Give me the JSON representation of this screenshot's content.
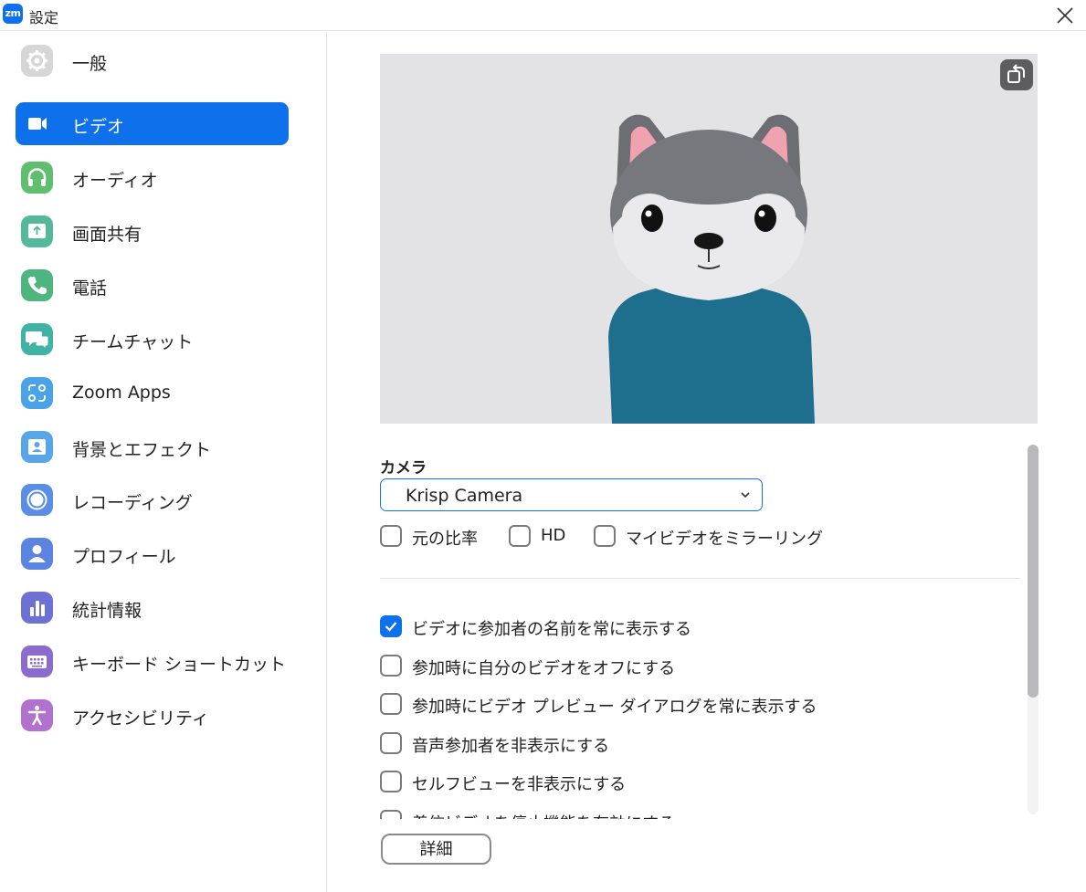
{
  "window": {
    "logo": "zm",
    "title": "設定"
  },
  "sidebar": {
    "items": [
      {
        "label": "一般",
        "icon": "gear-icon",
        "color": "#d6d6d6"
      },
      {
        "label": "ビデオ",
        "icon": "video-camera-icon",
        "color": "#0e71eb",
        "active": true
      },
      {
        "label": "オーディオ",
        "icon": "headphones-icon",
        "color": "#5fbf6e"
      },
      {
        "label": "画面共有",
        "icon": "share-screen-icon",
        "color": "#55b89a"
      },
      {
        "label": "電話",
        "icon": "phone-icon",
        "color": "#4fb57e"
      },
      {
        "label": "チームチャット",
        "icon": "chat-icon",
        "color": "#3fb4a6"
      },
      {
        "label": "Zoom Apps",
        "icon": "apps-icon",
        "color": "#4aa3e6"
      },
      {
        "label": "背景とエフェクト",
        "icon": "background-icon",
        "color": "#58a6e8"
      },
      {
        "label": "レコーディング",
        "icon": "record-icon",
        "color": "#5a8ee6"
      },
      {
        "label": "プロフィール",
        "icon": "profile-icon",
        "color": "#5b84e0"
      },
      {
        "label": "統計情報",
        "icon": "statistics-icon",
        "color": "#6c72d4"
      },
      {
        "label": "キーボード ショートカット",
        "icon": "keyboard-icon",
        "color": "#8a6ccf"
      },
      {
        "label": "アクセシビリティ",
        "icon": "accessibility-icon",
        "color": "#b071cf"
      }
    ]
  },
  "video": {
    "camera_label": "カメラ",
    "camera_value": "Krisp Camera",
    "camera_options": [
      {
        "label": "元の比率",
        "checked": false
      },
      {
        "label": "HD",
        "checked": false
      },
      {
        "label": "マイビデオをミラーリング",
        "checked": false
      }
    ],
    "settings": [
      {
        "label": "ビデオに参加者の名前を常に表示する",
        "checked": true
      },
      {
        "label": "参加時に自分のビデオをオフにする",
        "checked": false
      },
      {
        "label": "参加時にビデオ プレビュー ダイアログを常に表示する",
        "checked": false
      },
      {
        "label": "音声参加者を非表示にする",
        "checked": false
      },
      {
        "label": "セルフビューを非表示にする",
        "checked": false
      },
      {
        "label": "着信ビデオを停止機能を有効にする",
        "checked": false
      }
    ],
    "detail_button": "詳細"
  },
  "colors": {
    "accent": "#0e71eb",
    "preview_bg": "#e3e2e5"
  }
}
